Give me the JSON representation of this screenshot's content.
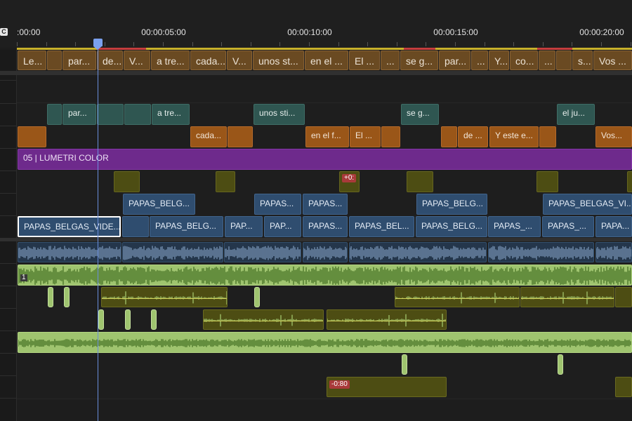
{
  "ruler": {
    "icon_label": "C",
    "timecodes": [
      {
        "id": "tc-0",
        "label": ":00:00"
      },
      {
        "id": "tc-5",
        "label": "00:00:05:00"
      },
      {
        "id": "tc-10",
        "label": "00:00:10:00"
      },
      {
        "id": "tc-15",
        "label": "00:00:15:00"
      },
      {
        "id": "tc-20",
        "label": "00:00:20:00"
      }
    ]
  },
  "tracks": {
    "captions": [
      "Le...",
      "",
      "par...",
      "de...",
      "V...",
      "a tre...",
      "cada...",
      "V...",
      "unos st...",
      "en el ...",
      "El ...",
      "...",
      "se g...",
      "par...",
      "...",
      "Y...",
      "co...",
      "...",
      "",
      "s...",
      "Vos ..."
    ],
    "v_teal": [
      "",
      "par...",
      "",
      "",
      "a tre...",
      "unos sti...",
      "se g...",
      "el ju..."
    ],
    "v_orange": [
      "",
      "cada...",
      "",
      "en el f...",
      "El ...",
      "",
      "",
      "de ...",
      "Y este e...",
      "",
      "Vos..."
    ],
    "adjustment": {
      "label": "05 | LUMETRI COLOR"
    },
    "v_olive_badge": "+0:",
    "v_blue_upper": [
      "PAPAS_BELG...",
      "PAPAS...",
      "PAPAS...",
      "PAPAS_BELG...",
      "PAPAS_BELGAS_VI..."
    ],
    "v_blue_main": [
      "PAPAS_BELGAS_VIDE...",
      "",
      "PAPAS_BELG...",
      "PAP...",
      "PAP...",
      "PAPAS...",
      "PAPAS_BEL...",
      "PAPAS_BELG...",
      "PAPAS_...",
      "PAPAS_...",
      "PAPA..."
    ],
    "a1_label": "1",
    "a_badge": "-0:80"
  },
  "colors": {
    "playhead": "#6a8edc",
    "caption": "#6a4a22",
    "teal": "#2f5651",
    "orange": "#9a5618",
    "adjustment": "#6e2a8c",
    "video": "#2f4d6f",
    "audio": "#9fc46f"
  }
}
